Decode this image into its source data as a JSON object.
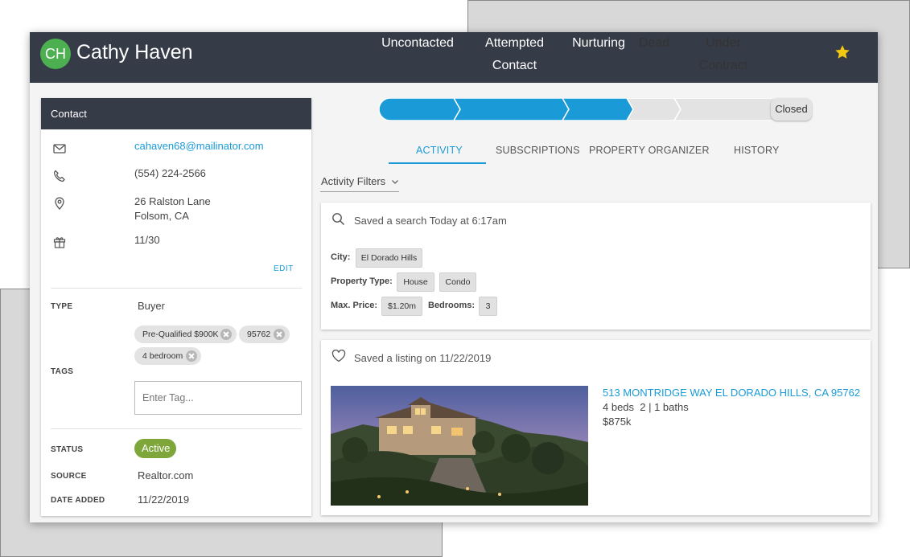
{
  "contact_header": {
    "initials": "CH",
    "name": "Cathy Haven",
    "favorite_icon": "star-icon",
    "colors": {
      "header_bg": "#363b48",
      "avatar_bg": "#4caf50",
      "star": "#f2c811"
    }
  },
  "contact_card": {
    "title": "Contact",
    "email": "cahaven68@mailinator.com",
    "phone": "(554) 224-2566",
    "address_line1": "26 Ralston Lane",
    "address_line2": "Folsom, CA",
    "birthday": "11/30",
    "edit_label": "EDIT",
    "type_label": "TYPE",
    "type_value": "Buyer",
    "tags_label": "TAGS",
    "tags": [
      "Pre-Qualified $900K",
      "95762",
      "4 bedroom"
    ],
    "tag_input_placeholder": "Enter Tag...",
    "status_label": "STATUS",
    "status_value": "Active",
    "source_label": "SOURCE",
    "source_value": "Realtor.com",
    "date_added_label": "DATE ADDED",
    "date_added_value": "11/22/2019"
  },
  "pipeline": {
    "stages": [
      "Uncontacted",
      "Attempted Contact",
      "Nurturing",
      "Dead",
      "Under Contract",
      "Closed"
    ],
    "completed_count": 3,
    "colors": {
      "done": "#1a9bd7",
      "pending": "#e3e3e3"
    }
  },
  "tabs": {
    "items": [
      "ACTIVITY",
      "SUBSCRIPTIONS",
      "PROPERTY ORGANIZER",
      "HISTORY"
    ],
    "active": "ACTIVITY"
  },
  "activity_filters_label": "Activity Filters",
  "saved_search": {
    "title": "Saved a search Today at 6:17am",
    "city_label": "City:",
    "city": "El Dorado Hills",
    "property_type_label": "Property Type:",
    "property_types": [
      "House",
      "Condo"
    ],
    "max_price_label": "Max. Price:",
    "max_price": "$1.20m",
    "bedrooms_label": "Bedrooms:",
    "bedrooms": "3"
  },
  "saved_listing": {
    "title": "Saved a listing on 11/22/2019",
    "address": "513 MONTRIDGE WAY EL DORADO HILLS, CA 95762",
    "beds_baths": "4 beds  2 | 1 baths",
    "price": "$875k"
  }
}
